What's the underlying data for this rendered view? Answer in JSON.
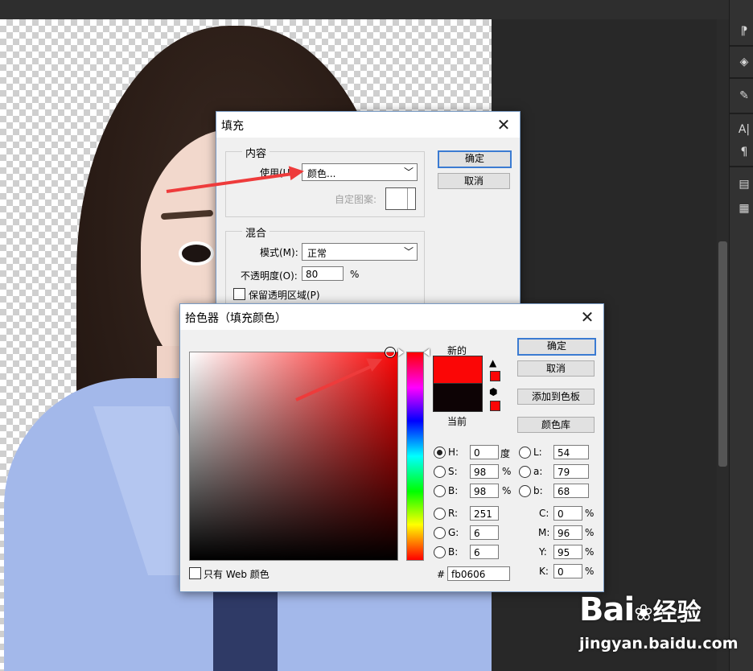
{
  "right_panel": {
    "icons": [
      "character-style-icon",
      "3d-cube-icon",
      "brush-preset-icon",
      "character-icon",
      "paragraph-icon",
      "properties-icon",
      "notes-icon"
    ]
  },
  "fill_dialog": {
    "title": "填充",
    "contents_group": "内容",
    "use_label": "使用(U):",
    "use_value": "颜色...",
    "custom_pattern_label": "自定图案:",
    "blending_group": "混合",
    "mode_label": "模式(M):",
    "mode_value": "正常",
    "opacity_label": "不透明度(O):",
    "opacity_value": "80",
    "opacity_unit": "%",
    "preserve_transparency_label": "保留透明区域(P)",
    "ok_label": "确定",
    "cancel_label": "取消"
  },
  "color_picker": {
    "title": "拾色器（填充颜色）",
    "new_label": "新的",
    "current_label": "当前",
    "ok_label": "确定",
    "cancel_label": "取消",
    "add_to_swatches_label": "添加到色板",
    "color_libraries_label": "颜色库",
    "only_web_colors_label": "只有 Web 颜色",
    "hsb": {
      "h_label": "H:",
      "h": "0",
      "h_unit": "度",
      "s_label": "S:",
      "s": "98",
      "s_unit": "%",
      "b_label": "B:",
      "b": "98",
      "b_unit": "%"
    },
    "rgb": {
      "r_label": "R:",
      "r": "251",
      "g_label": "G:",
      "g": "6",
      "b_label": "B:",
      "b": "6"
    },
    "lab": {
      "l_label": "L:",
      "l": "54",
      "a_label": "a:",
      "a": "79",
      "b_label": "b:",
      "b": "68"
    },
    "cmyk": {
      "c_label": "C:",
      "c": "0",
      "m_label": "M:",
      "m": "96",
      "y_label": "Y:",
      "y": "95",
      "k_label": "K:",
      "k": "0",
      "unit": "%"
    },
    "hex_label": "#",
    "hex": "fb0606",
    "colors": {
      "new": "#fb0606",
      "current": "#0d0305"
    }
  },
  "watermark": {
    "logo_text": "Bai",
    "logo_suffix": "经验",
    "url": "jingyan.baidu.com"
  }
}
